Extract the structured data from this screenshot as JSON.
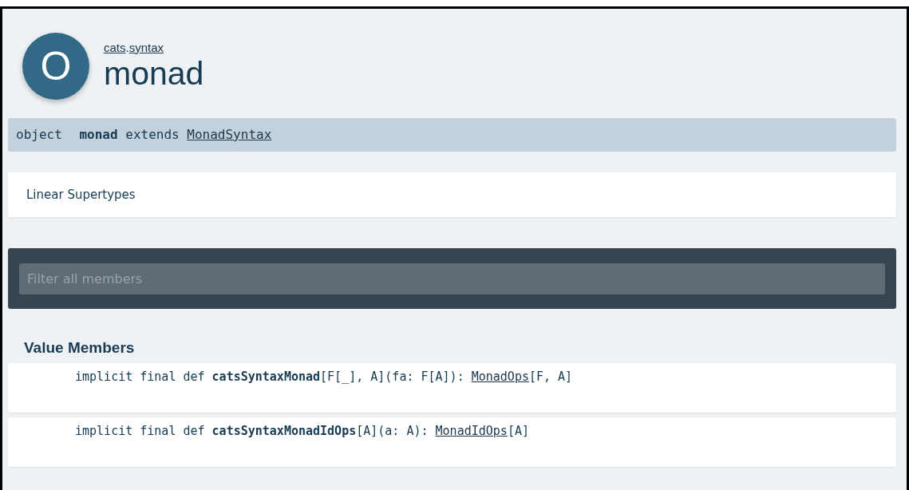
{
  "header": {
    "icon_letter": "O",
    "breadcrumb": {
      "links": [
        "cats",
        "syntax"
      ],
      "separator": "."
    },
    "title": "monad"
  },
  "signature": {
    "keyword": "object",
    "name": "monad",
    "extends_keyword": "extends",
    "parent_link": "MonadSyntax"
  },
  "linear_supertypes": {
    "label": "Linear Supertypes"
  },
  "filter": {
    "placeholder": "Filter all members"
  },
  "value_members": {
    "heading": "Value Members",
    "members": [
      {
        "modifiers": "implicit final def",
        "name": "catsSyntaxMonad",
        "params": "[F[_], A](fa: F[A]): ",
        "result_link": "MonadOps",
        "result_suffix": "[F, A]"
      },
      {
        "modifiers": "implicit final def",
        "name": "catsSyntaxMonadIdOps",
        "params": "[A](a: A): ",
        "result_link": "MonadIdOps",
        "result_suffix": "[A]"
      }
    ]
  }
}
